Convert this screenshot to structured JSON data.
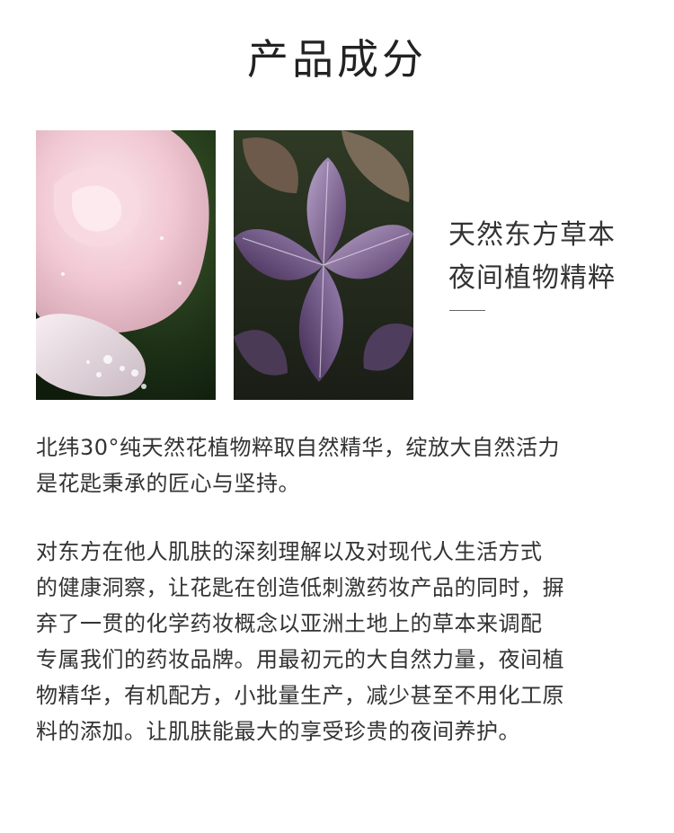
{
  "page": {
    "title": "产品成分"
  },
  "images": {
    "rose": "rose-photo",
    "perilla": "perilla-leaves-photo"
  },
  "tagline": {
    "line1": "天然东方草本",
    "line2": "夜间植物精粹"
  },
  "paragraph1": {
    "lines": [
      "北纬30°纯天然花植物粹取自然精华，绽放大自然活力",
      "是花匙秉承的匠心与坚持。"
    ]
  },
  "paragraph2": {
    "lines": [
      "对东方在他人肌肤的深刻理解以及对现代人生活方式",
      "的健康洞察，让花匙在创造低刺激药妆产品的同时，摒",
      "弃了一贯的化学药妆概念以亚洲土地上的草本来调配",
      "专属我们的药妆品牌。用最初元的大自然力量，夜间植",
      "物精华，有机配方，小批量生产，减少甚至不用化工原",
      "料的添加。让肌肤能最大的享受珍贵的夜间养护。"
    ]
  },
  "colors": {
    "text": "#333333",
    "title": "#222222",
    "divider": "#666666"
  }
}
